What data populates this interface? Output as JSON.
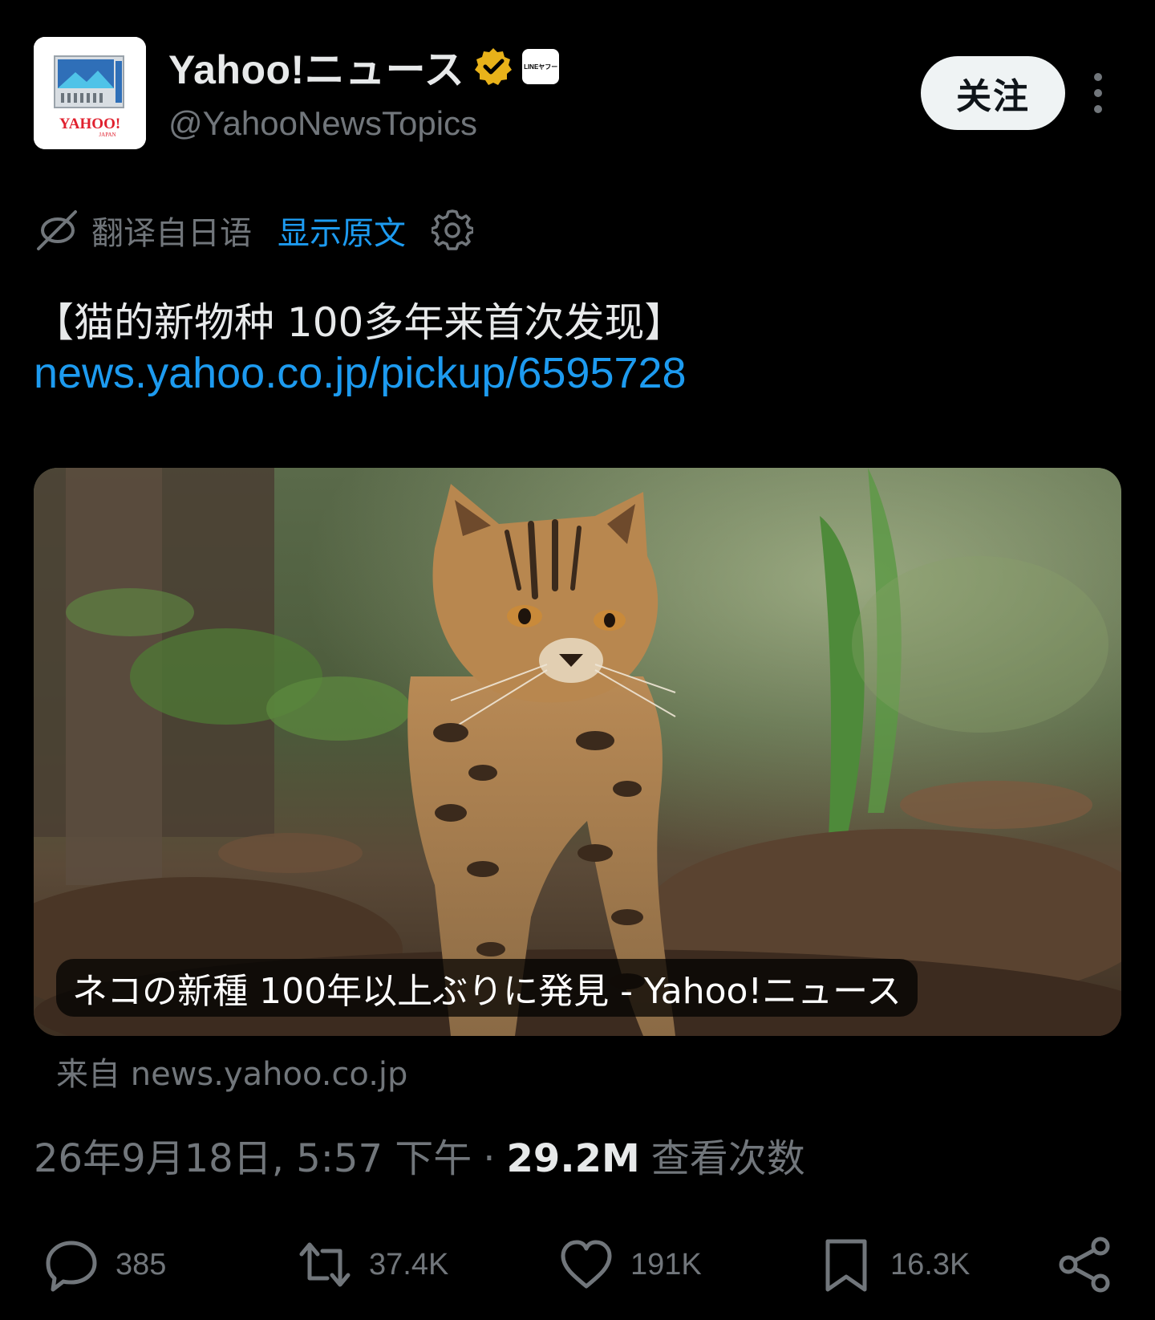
{
  "account": {
    "display_name": "Yahoo!ニュース",
    "handle": "@YahooNewsTopics",
    "avatar_text": "YAHOO! JAPAN",
    "affiliate_badge_text": "LINEヤフー",
    "verified_color": "#e8b21a"
  },
  "header": {
    "follow_label": "关注"
  },
  "translation": {
    "label": "翻译自日语",
    "show_original": "显示原文"
  },
  "tweet": {
    "title": "【猫的新物种 100多年来首次发现】",
    "link": "news.yahoo.co.jp/pickup/6595728"
  },
  "card": {
    "caption": "ネコの新種 100年以上ぶりに発見 - Yahoo!ニュース",
    "source": "来自 news.yahoo.co.jp"
  },
  "meta": {
    "timestamp": "26年9月18日, 5:57 下午",
    "separator": "·",
    "views_count": "29.2M",
    "views_label": "查看次数"
  },
  "actions": {
    "replies": "385",
    "reposts": "37.4K",
    "likes": "191K",
    "bookmarks": "16.3K"
  },
  "colors": {
    "background": "#000000",
    "accent_link": "#1d9bf0",
    "text_primary": "#e7e9ea",
    "text_secondary": "#71767b"
  }
}
